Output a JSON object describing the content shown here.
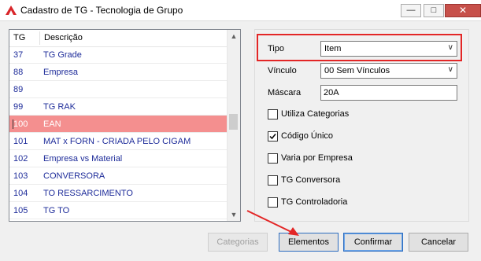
{
  "window": {
    "title": "Cadastro de TG - Tecnologia de Grupo",
    "icon": "app-icon",
    "controls": {
      "minimize": "—",
      "maximize": "□",
      "close": "✕"
    }
  },
  "list": {
    "columns": [
      "TG",
      "Descrição"
    ],
    "rows": [
      {
        "tg": "37",
        "desc": "TG Grade"
      },
      {
        "tg": "88",
        "desc": "Empresa"
      },
      {
        "tg": "89",
        "desc": ""
      },
      {
        "tg": "99",
        "desc": "TG RAK"
      },
      {
        "tg": "100",
        "desc": "EAN",
        "selected": true
      },
      {
        "tg": "101",
        "desc": "MAT x FORN - CRIADA PELO CIGAM"
      },
      {
        "tg": "102",
        "desc": "Empresa vs Material"
      },
      {
        "tg": "103",
        "desc": "CONVERSORA"
      },
      {
        "tg": "104",
        "desc": "TO RESSARCIMENTO"
      },
      {
        "tg": "105",
        "desc": "TG TO"
      }
    ],
    "scroll_up": "▲",
    "scroll_down": "▼"
  },
  "form": {
    "tipo_label": "Tipo",
    "tipo_value": "Item",
    "vinculo_label": "Vínculo",
    "vinculo_value": "00 Sem Vínculos",
    "mascara_label": "Máscara",
    "mascara_value": "20A",
    "dropdown_arrow": "∨",
    "checkboxes": [
      {
        "label": "Utiliza Categorias",
        "checked": false
      },
      {
        "label": "Código Único",
        "checked": true
      },
      {
        "label": "Varia por Empresa",
        "checked": false
      },
      {
        "label": "TG Conversora",
        "checked": false
      },
      {
        "label": "TG Controladoria",
        "checked": false
      }
    ]
  },
  "buttons": {
    "categorias": "Categorias",
    "elementos": "Elementos",
    "confirmar": "Confirmar",
    "cancelar": "Cancelar"
  },
  "colors": {
    "highlight": "#e32626",
    "selected_row": "#f48f8f",
    "list_text": "#1e2c9a"
  }
}
